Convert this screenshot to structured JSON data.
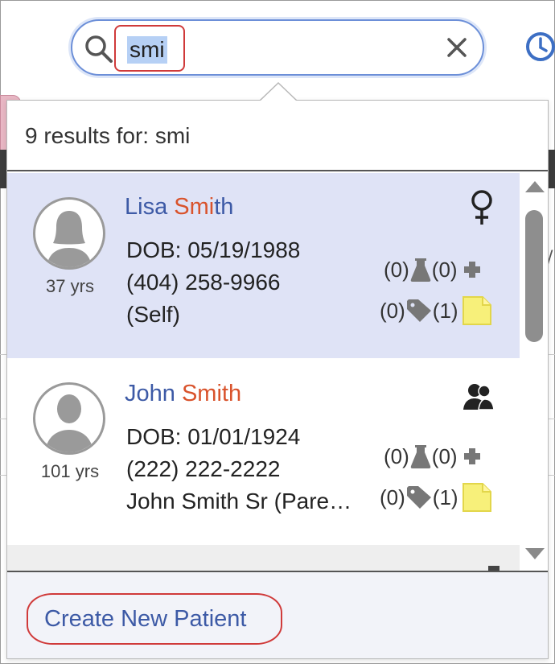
{
  "search": {
    "query": "smi",
    "clear_icon": "close-icon",
    "history_icon": "clock-icon"
  },
  "results": {
    "summary": "9 results for: smi"
  },
  "patients": [
    {
      "name_prefix": "Lisa ",
      "name_match": "Smi",
      "name_suffix": "th",
      "age": "37 yrs",
      "dob": "DOB: 05/19/1988",
      "phone": "(404) 258-9966",
      "relation": "(Self)",
      "type_icon": "female-icon",
      "lab_count": "(0)",
      "med_count": "(0)",
      "tag_count": "(0)",
      "note_count": "(1)",
      "selected": true
    },
    {
      "name_prefix": "John ",
      "name_match": "Smi",
      "name_suffix": "th",
      "age": "101 yrs",
      "dob": "DOB: 01/01/1924",
      "phone": "(222) 222-2222",
      "relation": "John Smith Sr (Pare…",
      "type_icon": "family-icon",
      "lab_count": "(0)",
      "med_count": "(0)",
      "tag_count": "(0)",
      "note_count": "(1)",
      "selected": false
    }
  ],
  "footer": {
    "create_label": "Create New Patient"
  },
  "colors": {
    "accent": "#3d5aa6",
    "match_highlight": "#d9532c",
    "selected_row": "#dfe3f6",
    "annotation_red": "#d03a3a",
    "note_yellow": "#f7f07a"
  }
}
